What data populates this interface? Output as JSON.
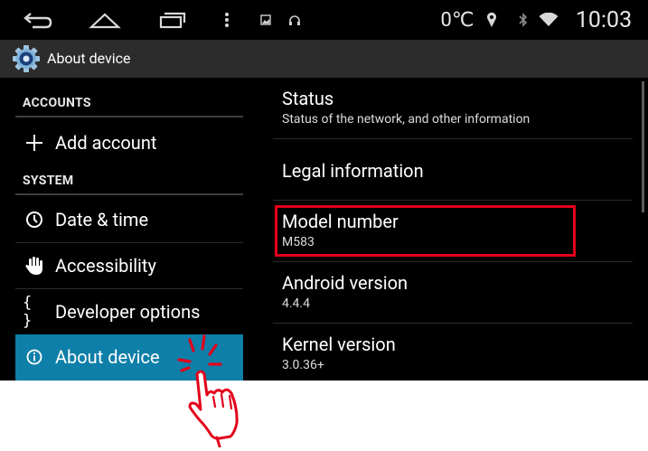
{
  "status_bar": {
    "temperature": "0℃",
    "time": "10:03"
  },
  "action_bar": {
    "title": "About device"
  },
  "left_panel": {
    "accounts_header": "ACCOUNTS",
    "add_account": "Add account",
    "system_header": "SYSTEM",
    "items": [
      {
        "label": "Date & time",
        "icon": "clock-icon"
      },
      {
        "label": "Accessibility",
        "icon": "hand-icon"
      },
      {
        "label": "Developer options",
        "icon": "braces-icon"
      },
      {
        "label": "About device",
        "icon": "info-icon",
        "selected": true
      }
    ],
    "braces": "{ }"
  },
  "right_panel": {
    "items": [
      {
        "title": "Status",
        "summary": "Status of the network, and other information"
      },
      {
        "title": "Legal information",
        "summary": ""
      },
      {
        "title": "Model number",
        "summary": "M583"
      },
      {
        "title": "Android version",
        "summary": "4.4.4"
      },
      {
        "title": "Kernel version",
        "summary": "3.0.36+"
      }
    ]
  },
  "colors": {
    "selected_bg": "#0e7fa8",
    "highlight_border": "#e3001b"
  }
}
